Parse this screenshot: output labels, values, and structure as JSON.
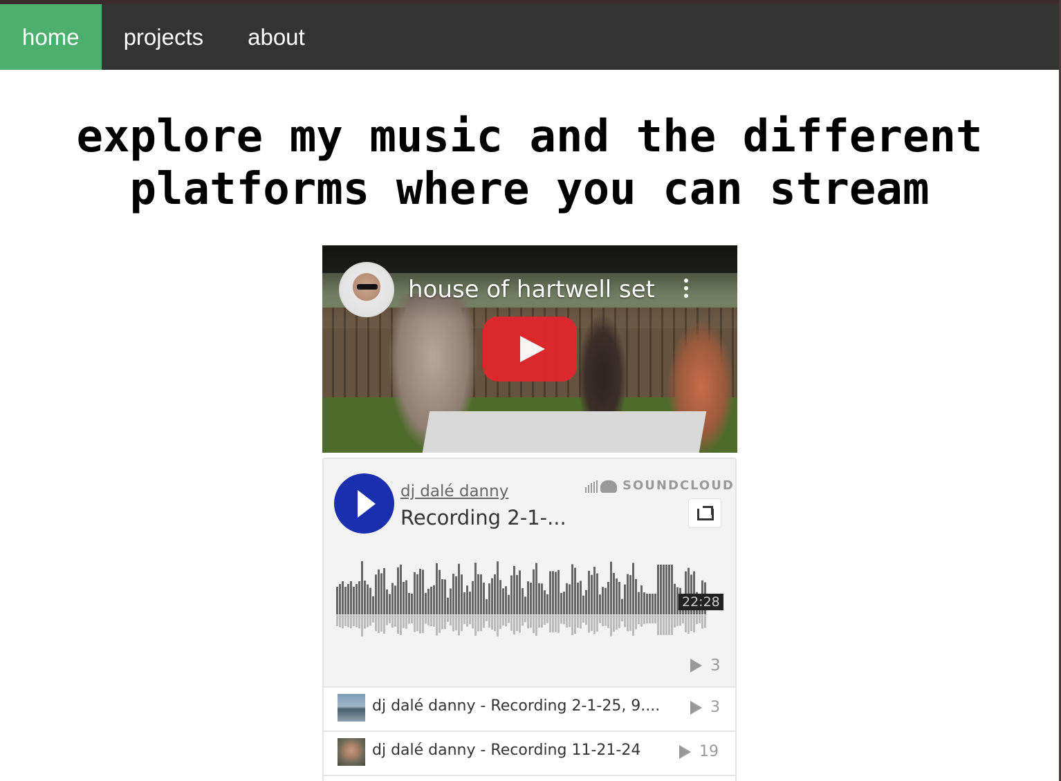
{
  "nav": {
    "items": [
      {
        "label": "home",
        "active": true
      },
      {
        "label": "projects",
        "active": false
      },
      {
        "label": "about",
        "active": false
      }
    ],
    "active_color": "#4CAF6E",
    "bar_color": "#333333"
  },
  "headline": {
    "line1": "explore my music and the different",
    "line2": "platforms where you can stream"
  },
  "youtube": {
    "video_title": "house of hartwell set",
    "play_button_color": "#e1262d",
    "icons": [
      "channel-avatar",
      "more-vert-icon",
      "play-icon"
    ]
  },
  "soundcloud": {
    "artist": "dj dalé danny",
    "track_title": "Recording 2-1-...",
    "logo_text": "SOUNDCLOUD",
    "duration": "22:28",
    "play_count": "3",
    "play_button_color": "#1a2fae",
    "tracks": [
      {
        "title": "dj dalé danny - Recording 2-1-25, 9....",
        "plays": "3"
      },
      {
        "title": "dj dalé danny - Recording 11-21-24",
        "plays": "19"
      }
    ]
  }
}
